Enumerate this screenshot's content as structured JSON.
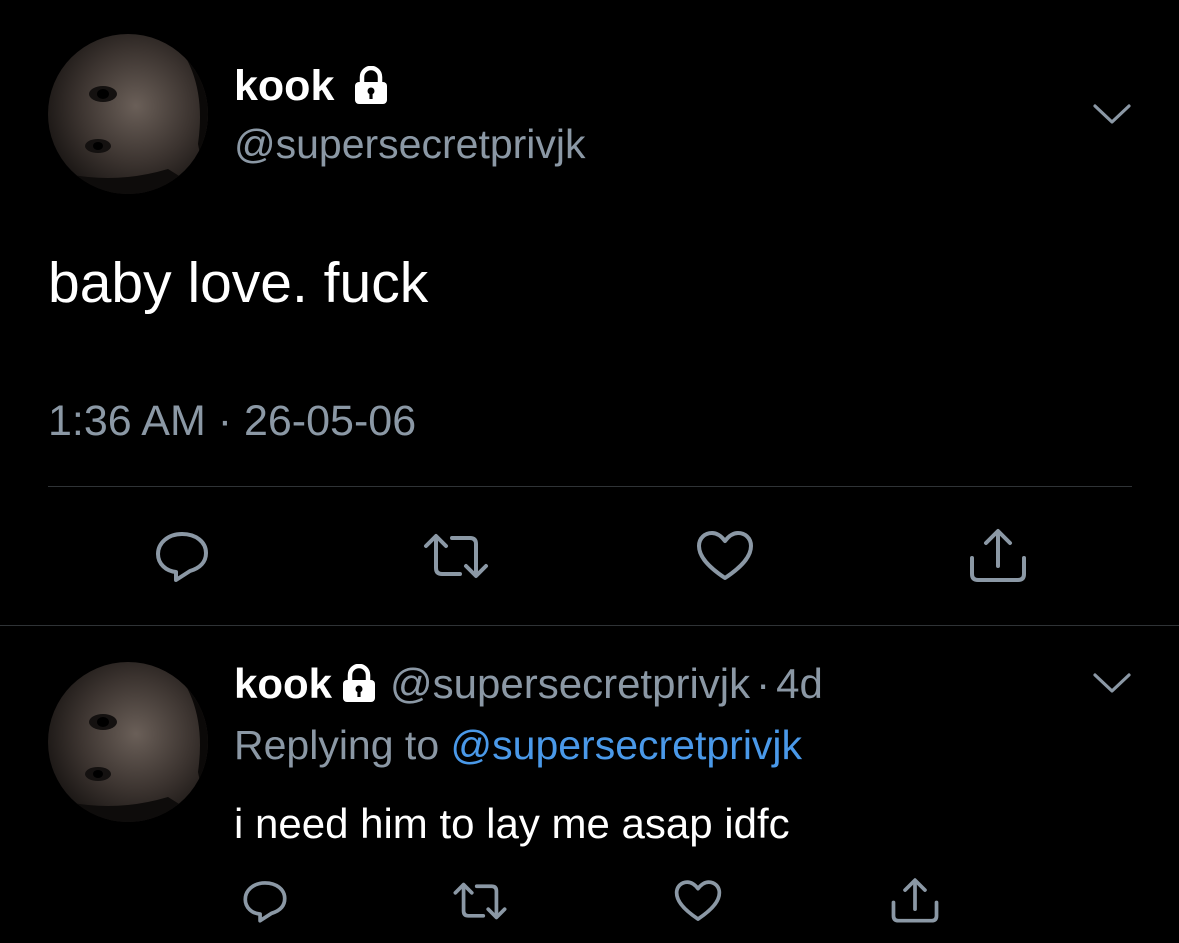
{
  "main_tweet": {
    "display_name": "kook",
    "handle": "@supersecretprivjk",
    "text": "baby love. fuck",
    "timestamp": "1:36 AM · 26-05-06",
    "icons": {
      "lock": "lock-icon",
      "menu": "chevron-down-icon",
      "reply": "reply-icon",
      "retweet": "retweet-icon",
      "like": "heart-icon",
      "share": "share-icon"
    }
  },
  "reply_tweet": {
    "display_name": "kook",
    "handle": "@supersecretprivjk",
    "separator": "·",
    "age": "4d",
    "replying_prefix": "Replying to",
    "replying_to": "@supersecretprivjk",
    "text": "i need him to lay me asap idfc"
  },
  "colors": {
    "background": "#000000",
    "primary_text": "#ffffff",
    "secondary_text": "#8b98a5",
    "link": "#4a99e9",
    "divider": "#2f3336"
  }
}
